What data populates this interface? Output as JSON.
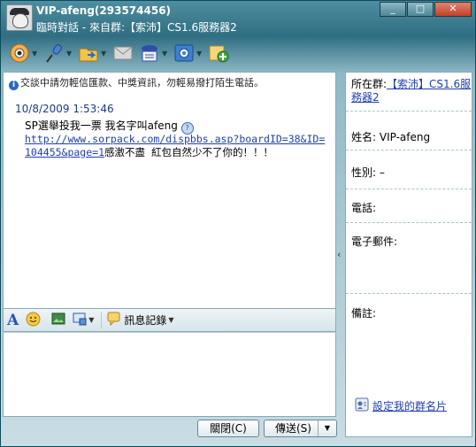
{
  "window": {
    "title_name": "VIP-afeng(293574456)",
    "title_sub": "臨時對話 - 來自群:【索沛】CS1.6服務器2",
    "min_glyph": "_",
    "max_glyph": "□",
    "close_glyph": "✕"
  },
  "toolbar": {
    "items": [
      {
        "icon": "video-camera-icon"
      },
      {
        "icon": "microphone-icon"
      },
      {
        "icon": "send-file-folder-icon"
      },
      {
        "icon": "message-envelope-icon"
      },
      {
        "icon": "contact-card-icon"
      },
      {
        "icon": "settings-gear-icon"
      },
      {
        "icon": "add-plus-icon"
      }
    ]
  },
  "chat": {
    "notice": "交談中請勿輕信匯款、中獎資訊，勿輕易撥打陌生電話。",
    "message": {
      "time": "10/8/2009 1:53:46",
      "line1": "SP選舉投我一票  我名字叫afeng",
      "link_line1": "http://www.sorpack.com/dispbbs.asp?boardID=38&ID=",
      "link_line2": "104455&page=1",
      "tail": "感激不盡  紅包自然少不了你的！！！"
    }
  },
  "format_bar": {
    "font_glyph": "A",
    "history_label": "訊息記錄"
  },
  "buttons": {
    "close_label": "關閉(C)",
    "send_label": "傳送(S)"
  },
  "info_panel": {
    "group_label": "所在群:",
    "group_name": "【索沛】CS1.6服務器2",
    "name_label": "姓名:",
    "name_value": "VIP-afeng",
    "gender_label": "性別:",
    "gender_value": "–",
    "phone_label": "電話:",
    "email_label": "電子郵件:",
    "note_label": "備註:",
    "card_link": "設定我的群名片"
  }
}
